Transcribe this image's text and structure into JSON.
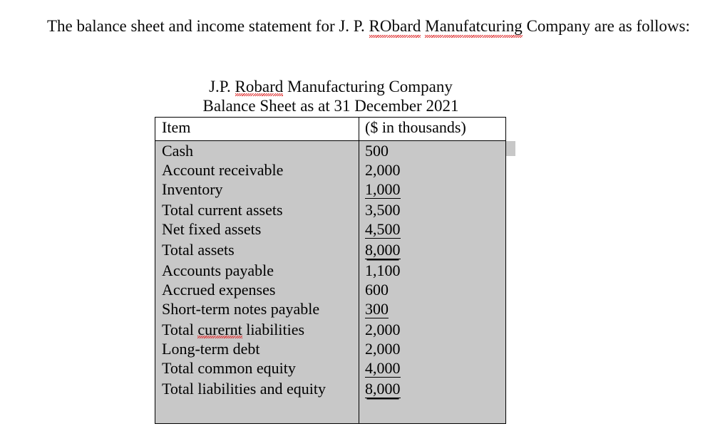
{
  "document": {
    "intro": {
      "before_first_misspell": "The balance sheet and income statement for J. P. ",
      "misspell_1": "RObard",
      "between": " ",
      "misspell_2": "Manufatcuring",
      "after": " Company are as follows:"
    },
    "table_caption": {
      "line1_prefix": "J.P. ",
      "line1_misspell": "Robard",
      "line1_suffix": " Manufacturing Company",
      "line2": "Balance Sheet as at 31 December 2021"
    },
    "table": {
      "headers": {
        "item": "Item",
        "value": "($ in thousands)"
      },
      "rows": [
        {
          "item": "Cash",
          "value": "500",
          "underline": "none"
        },
        {
          "item": "Account receivable",
          "value": "2,000",
          "underline": "none"
        },
        {
          "item": "Inventory",
          "value": "1,000",
          "underline": "single"
        },
        {
          "item": "Total current assets",
          "value": "3,500",
          "underline": "none"
        },
        {
          "item": "Net fixed assets",
          "value": "4,500",
          "underline": "single"
        },
        {
          "item": "Total assets",
          "value": "8,000",
          "underline": "double"
        },
        {
          "item": "Accounts payable",
          "value": "1,100",
          "underline": "none"
        },
        {
          "item": "Accrued expenses",
          "value": "600",
          "underline": "none"
        },
        {
          "item": "Short-term notes payable",
          "value": "300",
          "underline": "single"
        },
        {
          "item_prefix": "Total ",
          "item_misspell": "curernt",
          "item_suffix": " liabilities",
          "item": "Total curernt liabilities",
          "value": "2,000",
          "underline": "none"
        },
        {
          "item": "Long-term debt",
          "value": "2,000",
          "underline": "none"
        },
        {
          "item": "Total common equity",
          "value": "4,000",
          "underline": "single"
        },
        {
          "item": "Total liabilities and equity",
          "value": "8,000",
          "underline": "double"
        }
      ]
    },
    "colors": {
      "page_background": "#ffffff",
      "table_fill": "#c8c8c8",
      "border": "#000000",
      "text": "#0a0a0a",
      "spellcheck_underline": "#e03030"
    }
  }
}
